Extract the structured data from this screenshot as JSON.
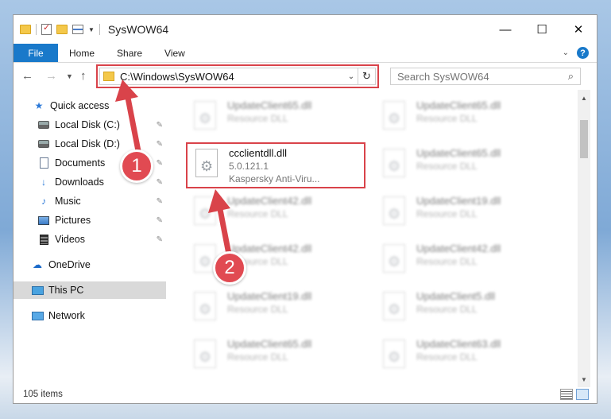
{
  "window": {
    "title": "SysWOW64"
  },
  "titlebar": {
    "minimize": "—",
    "maximize": "☐",
    "close": "✕"
  },
  "ribbon": {
    "tabs": [
      {
        "label": "File"
      },
      {
        "label": "Home"
      },
      {
        "label": "Share"
      },
      {
        "label": "View"
      }
    ],
    "help_label": "?"
  },
  "address": {
    "path": "C:\\Windows\\SysWOW64",
    "refresh_glyph": "↻"
  },
  "search": {
    "placeholder": "Search SysWOW64"
  },
  "sidebar": {
    "items": [
      {
        "label": "Quick access",
        "icon": "star-icon"
      },
      {
        "label": "Local Disk (C:)",
        "icon": "disk-icon"
      },
      {
        "label": "Local Disk (D:)",
        "icon": "disk-icon"
      },
      {
        "label": "Documents",
        "icon": "documents-icon"
      },
      {
        "label": "Downloads",
        "icon": "download-icon"
      },
      {
        "label": "Music",
        "icon": "music-icon"
      },
      {
        "label": "Pictures",
        "icon": "pictures-icon"
      },
      {
        "label": "Videos",
        "icon": "videos-icon"
      },
      {
        "label": "OneDrive",
        "icon": "cloud-icon"
      },
      {
        "label": "This PC",
        "icon": "computer-icon"
      },
      {
        "label": "Network",
        "icon": "network-icon"
      }
    ]
  },
  "files": [
    {
      "name": "UpdateClient65.dll",
      "type": "Resource DLL"
    },
    {
      "name": "UpdateClient65.dll",
      "type": "Resource DLL"
    },
    {
      "name": "ccclientdll.dll",
      "version": "5.0.121.1",
      "company": "Kaspersky Anti-Viru..."
    },
    {
      "name": "UpdateClient65.dll",
      "type": "Resource DLL"
    },
    {
      "name": "UpdateClient42.dll",
      "type": "Resource DLL"
    },
    {
      "name": "UpdateClient19.dll",
      "type": "Resource DLL"
    },
    {
      "name": "UpdateClient42.dll",
      "type": "Resource DLL"
    },
    {
      "name": "UpdateClient42.dll",
      "type": "Resource DLL"
    },
    {
      "name": "UpdateClient19.dll",
      "type": "Resource DLL"
    },
    {
      "name": "UpdateClient5.dll",
      "type": "Resource DLL"
    },
    {
      "name": "UpdateClient65.dll",
      "type": "Resource DLL"
    },
    {
      "name": "UpdateClient63.dll",
      "type": "Resource DLL"
    }
  ],
  "status": {
    "item_count": "105 items"
  },
  "annotations": {
    "step1": "1",
    "step2": "2",
    "color": "#d9434a"
  }
}
